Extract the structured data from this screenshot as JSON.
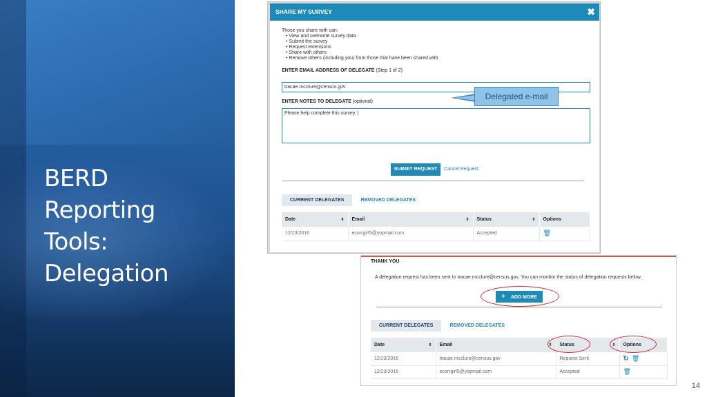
{
  "slide": {
    "title_lines": [
      "BERD",
      "Reporting",
      "Tools:",
      "Delegation"
    ],
    "page_number": "14"
  },
  "share_dialog": {
    "title": "SHARE MY SURVEY",
    "close_glyph": "✖",
    "intro": "Those you share with can:",
    "permissions": [
      "View and overwrite survey data",
      "Submit the survey",
      "Request extensions",
      "Share with others",
      "Remove others (including you) from those that have been shared with"
    ],
    "email_label": "ENTER EMAIL ADDRESS OF DELEGATE",
    "email_hint": "(Step 1 of 2)",
    "email_value": "tracae.mcclure@census.gov",
    "notes_label": "ENTER NOTES TO DELEGATE",
    "notes_hint": "(optional)",
    "notes_value": "Please help complete this survey. |",
    "callout": "Delegated e-mail",
    "submit_label": "SUBMIT REQUEST",
    "cancel_label": "Cancel Request",
    "tabs": [
      "CURRENT DELEGATES",
      "REMOVED DELEGATES"
    ],
    "columns": [
      "Date",
      "Email",
      "Status",
      "Options"
    ],
    "rows": [
      {
        "date": "12/23/2016",
        "email": "ecorrgirl5@yopmail.com",
        "status": "Accepted"
      }
    ]
  },
  "thank_you": {
    "title": "THANK YOU",
    "message": "A delegation request has been sent to tracae.mcclure@census.gov. You can monitor the status of delegation requests below.",
    "add_more_plus": "+",
    "add_more_label": "ADD MORE",
    "tabs": [
      "CURRENT DELEGATES",
      "REMOVED DELEGATES"
    ],
    "columns": [
      "Date",
      "Email",
      "Status",
      "Options"
    ],
    "rows": [
      {
        "date": "12/23/2016",
        "email": "tracae.mcclure@census.gov",
        "status": "Request Sent"
      },
      {
        "date": "12/23/2016",
        "email": "ecorrgirl5@yopmail.com",
        "status": "Accepted"
      }
    ]
  },
  "icons": {
    "sort": "⬍",
    "trash": "🗑",
    "refresh": "↻"
  },
  "colors": {
    "accent": "#1e8ab8",
    "highlight_ring": "#d6262f",
    "callout_fill": "#8fc4e8"
  }
}
